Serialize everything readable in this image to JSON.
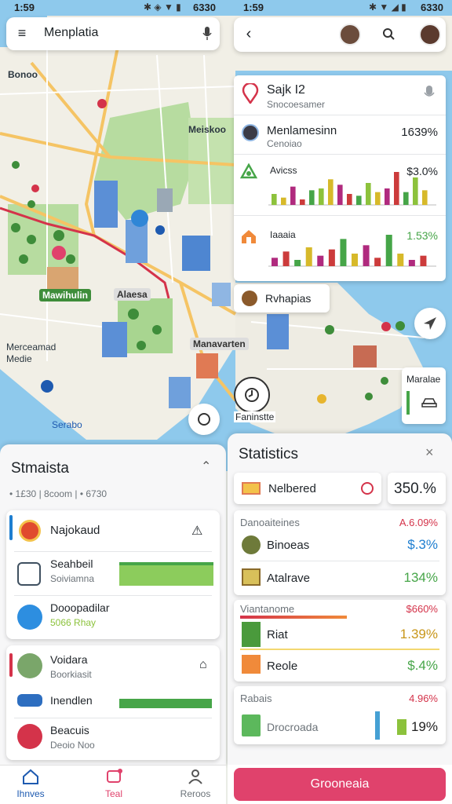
{
  "status_left": {
    "time": "1:59",
    "battery": "6330"
  },
  "status_right": {
    "time": "1:59",
    "battery": "6330"
  },
  "search": {
    "value": "Menplatia"
  },
  "map": {
    "labels": [
      "Bonoo",
      "Meiskoo",
      "Merceamad\nMedie",
      "Serabo",
      "Mawihulin",
      "Alaesa",
      "Manavarten",
      "Faninstte"
    ],
    "top_text": "Sajk I2",
    "top_sub": "Snocoesamer"
  },
  "info_panel": {
    "row1": {
      "name": "Menlamesinn",
      "sub": "Cenoiao",
      "value": "1639%"
    },
    "chart1": {
      "label": "Avicss",
      "value": "$3.0%"
    },
    "chart2": {
      "label": "Iaaaia",
      "value": "1.53%"
    },
    "row2": {
      "name": "Rvhapias"
    }
  },
  "map_side_panel": {
    "label": "Maralae"
  },
  "map_marker_label": "Faninstte",
  "chart_data": [
    {
      "type": "bar",
      "title": "",
      "categories": [
        "1",
        "2",
        "3",
        "4",
        "5",
        "6",
        "7",
        "8",
        "9",
        "10",
        "11",
        "12",
        "13",
        "14",
        "15",
        "16",
        "17"
      ],
      "series": [
        {
          "values": [
            6,
            4,
            10,
            3,
            8,
            9,
            14,
            11,
            6,
            5,
            12,
            7,
            9,
            18,
            7,
            15,
            8
          ]
        }
      ],
      "colors": [
        "#8dc23c",
        "#d7b92a",
        "#b02a7e",
        "#cc3b3b",
        "#46a548"
      ]
    },
    {
      "type": "bar",
      "title": "",
      "categories": [
        "1",
        "2",
        "3",
        "4",
        "5",
        "6",
        "7",
        "8",
        "9",
        "10",
        "11",
        "12",
        "13",
        "14"
      ],
      "series": [
        {
          "values": [
            4,
            7,
            3,
            9,
            5,
            8,
            13,
            6,
            10,
            4,
            15,
            6,
            3,
            5
          ]
        }
      ],
      "colors": [
        "#b02a7e",
        "#cc3b3b",
        "#46a548",
        "#d7b92a"
      ]
    }
  ],
  "left_panel": {
    "title": "Stmaista",
    "subtitle": "• 1£30 | 8coom | • 6730",
    "items_group1": [
      {
        "name": "Najokaud",
        "sub": ""
      },
      {
        "name": "Seahbeil",
        "sub": "Soiviamna"
      },
      {
        "name": "Dooopadilar",
        "sub": "5066 Rhay"
      }
    ],
    "items_group2": [
      {
        "name": "Voidara",
        "sub": "Boorkiasit"
      },
      {
        "name": "Inendlen",
        "sub": ""
      },
      {
        "name": "Beacuis",
        "sub": "Deoio Noo"
      }
    ]
  },
  "stats_panel": {
    "title": "Statistics",
    "highlight": {
      "name": "Nelbered",
      "value": "350.%"
    },
    "group1": {
      "header": "Danoaiteines",
      "header_value": "A.6.09%",
      "rows": [
        {
          "name": "Binoeas",
          "value": "$.3%"
        },
        {
          "name": "Atalrave",
          "value": "134%"
        }
      ]
    },
    "group2": {
      "header": "Viantanome",
      "header_value": "$660%",
      "rows": [
        {
          "name": "Riat",
          "value": "1.39%"
        },
        {
          "name": "Reole",
          "value": "$.4%"
        }
      ]
    },
    "group3": {
      "header": "Rabais",
      "header_value": "4.96%",
      "rows": [
        {
          "name": "Drocroada",
          "value": "19%"
        }
      ]
    },
    "cta": "Grooneaia"
  },
  "bottom_nav": [
    {
      "label": "Ihnves",
      "icon": "home-icon"
    },
    {
      "label": "Teal",
      "icon": "message-icon"
    },
    {
      "label": "Reroos",
      "icon": "profile-icon"
    }
  ],
  "colors": {
    "accent": "#e0426c",
    "green": "#46a548",
    "blue": "#1e7ed0",
    "water": "#8ec9ec",
    "land": "#f1efe6",
    "park": "#b7dca0"
  }
}
